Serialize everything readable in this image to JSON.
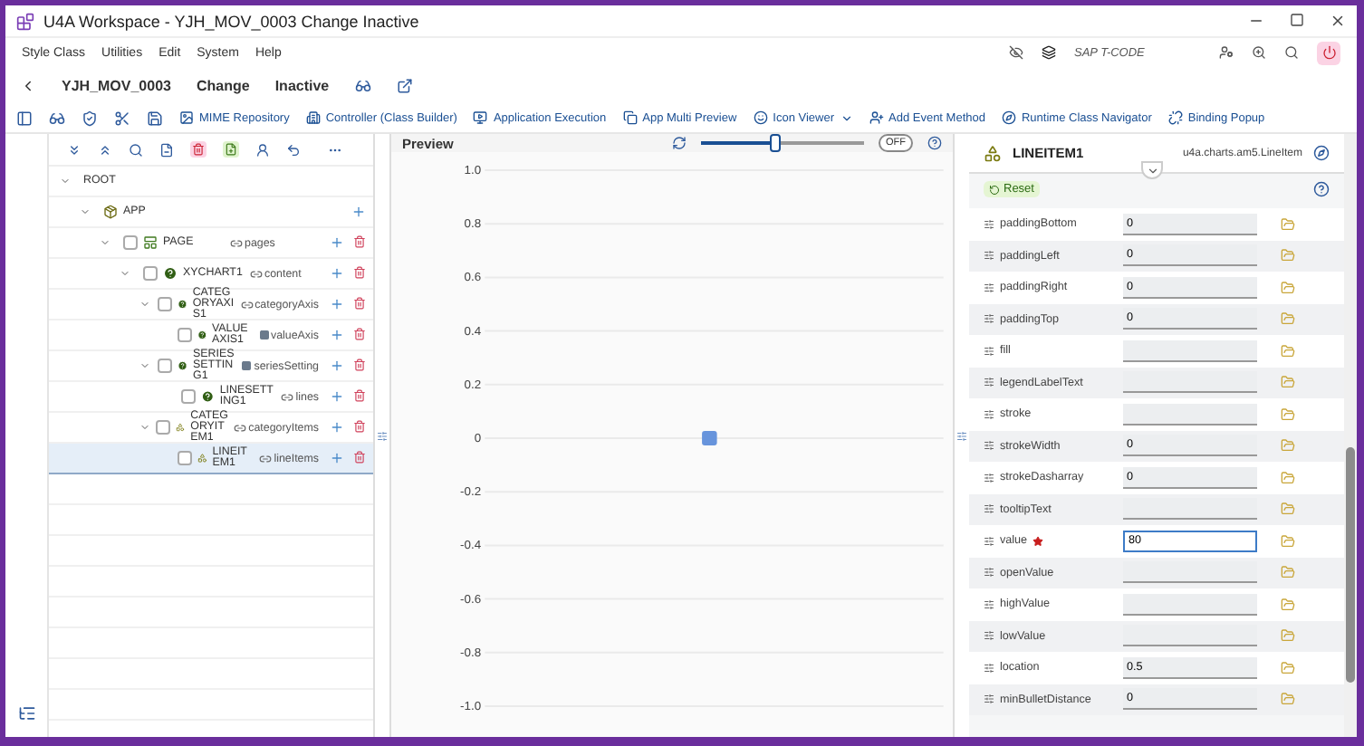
{
  "window": {
    "title": "U4A Workspace - YJH_MOV_0003 Change Inactive"
  },
  "menu": [
    "Style Class",
    "Utilities",
    "Edit",
    "System",
    "Help"
  ],
  "tcode": {
    "placeholder": "SAP T-CODE"
  },
  "header": {
    "app_id": "YJH_MOV_0003",
    "mode": "Change",
    "status": "Inactive"
  },
  "toolbar": [
    {
      "label": "MIME Repository",
      "dropdown": false
    },
    {
      "label": "Controller (Class Builder)",
      "dropdown": false
    },
    {
      "label": "Application Execution",
      "dropdown": false
    },
    {
      "label": "App Multi Preview",
      "dropdown": false
    },
    {
      "label": "Icon Viewer",
      "dropdown": true
    },
    {
      "label": "Add Event Method",
      "dropdown": false
    },
    {
      "label": "Runtime Class Navigator",
      "dropdown": false
    },
    {
      "label": "Binding Popup",
      "dropdown": false
    }
  ],
  "tree": [
    {
      "name": "ROOT",
      "expanded": true,
      "add": false,
      "delete": false,
      "selected": false,
      "children": [
        {
          "name": "APP",
          "kind": "app",
          "expanded": true,
          "add": true,
          "delete": false,
          "selected": false,
          "children": [
            {
              "name": "PAGE",
              "kind": "page",
              "checked": false,
              "expanded": true,
              "add": true,
              "delete": true,
              "selected": false,
              "aggregation": {
                "label": "pages",
                "kind": "multi"
              },
              "children": [
                {
                  "name": "XYCHART1",
                  "kind": "control",
                  "checked": false,
                  "expanded": true,
                  "add": true,
                  "delete": true,
                  "selected": false,
                  "aggregation": {
                    "label": "content",
                    "kind": "multi"
                  },
                  "children": [
                    {
                      "name": "CATEGORYAXIS1",
                      "kind": "control",
                      "checked": false,
                      "expanded": true,
                      "add": true,
                      "delete": true,
                      "selected": false,
                      "aggregation": {
                        "label": "categoryAxis",
                        "kind": "multi"
                      },
                      "children": [
                        {
                          "name": "VALUEAXIS1",
                          "kind": "control",
                          "checked": false,
                          "add": true,
                          "delete": true,
                          "selected": false,
                          "aggregation": {
                            "label": "valueAxis",
                            "kind": "single"
                          }
                        }
                      ]
                    },
                    {
                      "name": "SERIESSETTING1",
                      "kind": "control",
                      "checked": false,
                      "expanded": true,
                      "add": true,
                      "delete": true,
                      "selected": false,
                      "aggregation": {
                        "label": "seriesSetting",
                        "kind": "single"
                      },
                      "children": [
                        {
                          "name": "LINESETTING1",
                          "kind": "control",
                          "checked": false,
                          "add": true,
                          "delete": true,
                          "selected": false,
                          "aggregation": {
                            "label": "lines",
                            "kind": "multi"
                          }
                        }
                      ]
                    },
                    {
                      "name": "CATEGORYITEM1",
                      "kind": "item",
                      "checked": false,
                      "expanded": true,
                      "add": true,
                      "delete": true,
                      "selected": false,
                      "aggregation": {
                        "label": "categoryItems",
                        "kind": "multi"
                      },
                      "children": [
                        {
                          "name": "LINEITEM1",
                          "kind": "item",
                          "checked": false,
                          "add": true,
                          "delete": true,
                          "selected": true,
                          "aggregation": {
                            "label": "lineItems",
                            "kind": "multi"
                          }
                        }
                      ]
                    }
                  ]
                }
              ]
            }
          ]
        }
      ]
    }
  ],
  "preview": {
    "title": "Preview",
    "zoom": {
      "level": 0.45
    },
    "toggle": {
      "label": "OFF",
      "on": false
    },
    "chart_data": {
      "type": "line",
      "ylim": [
        -1,
        1
      ],
      "yticks": [
        {
          "value": 1,
          "label": "1.0"
        },
        {
          "value": 0.8,
          "label": "0.8"
        },
        {
          "value": 0.6,
          "label": "0.6"
        },
        {
          "value": 0.4,
          "label": "0.4"
        },
        {
          "value": 0.2,
          "label": "0.2"
        },
        {
          "value": 0,
          "label": "0"
        },
        {
          "value": -0.2,
          "label": "-0.2"
        },
        {
          "value": -0.4,
          "label": "-0.4"
        },
        {
          "value": -0.6,
          "label": "-0.6"
        },
        {
          "value": -0.8,
          "label": "-0.8"
        },
        {
          "value": -1,
          "label": "-1.0"
        }
      ],
      "grid": true,
      "series": [
        {
          "color": "#6794dc",
          "marker": "square",
          "values": [
            0
          ]
        }
      ]
    }
  },
  "properties": {
    "title": "LINEITEM1",
    "class_name": "u4a.charts.am5.LineItem",
    "reset": "Reset",
    "rows": [
      {
        "name": "paddingBottom",
        "value": "0",
        "required": false,
        "focused": false
      },
      {
        "name": "paddingLeft",
        "value": "0",
        "required": false,
        "focused": false
      },
      {
        "name": "paddingRight",
        "value": "0",
        "required": false,
        "focused": false
      },
      {
        "name": "paddingTop",
        "value": "0",
        "required": false,
        "focused": false
      },
      {
        "name": "fill",
        "required": false,
        "focused": false
      },
      {
        "name": "legendLabelText",
        "required": false,
        "focused": false
      },
      {
        "name": "stroke",
        "required": false,
        "focused": false
      },
      {
        "name": "strokeWidth",
        "value": "0",
        "required": false,
        "focused": false
      },
      {
        "name": "strokeDasharray",
        "value": "0",
        "required": false,
        "focused": false
      },
      {
        "name": "tooltipText",
        "required": false,
        "focused": false
      },
      {
        "name": "value",
        "value": "80",
        "required": true,
        "focused": true
      },
      {
        "name": "openValue",
        "required": false,
        "focused": false
      },
      {
        "name": "highValue",
        "required": false,
        "focused": false
      },
      {
        "name": "lowValue",
        "required": false,
        "focused": false
      },
      {
        "name": "location",
        "value": "0.5",
        "required": false,
        "focused": false
      },
      {
        "name": "minBulletDistance",
        "value": "0",
        "required": false,
        "focused": false
      }
    ]
  }
}
